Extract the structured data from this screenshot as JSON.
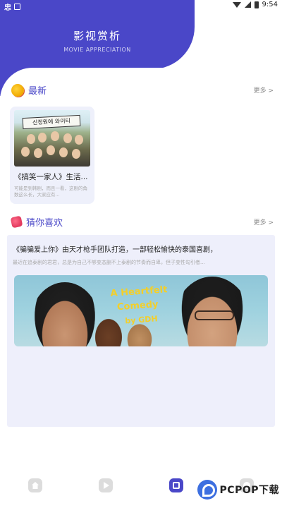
{
  "status_bar": {
    "app_badge": "忠",
    "time": "9:54"
  },
  "header": {
    "title": "影视赏析",
    "subtitle": "MOVIE APPRECIATION"
  },
  "latest": {
    "heading": "最新",
    "more": "更多 >",
    "card": {
      "poster_sign": "신정원에 와이티",
      "title": "《搞笑一家人》生活...",
      "description": "可能是到韩剧，而且一看，这剧的角数这么长，大家应有..."
    }
  },
  "guess": {
    "heading": "猜你喜欢",
    "more": "更多 >",
    "item": {
      "title": "《骗骗爱上你》由天才枪手团队打造，一部轻松愉快的泰国喜剧，",
      "description": "最近在追泰剧的君君，总是为自己不够变态删不上泰剧的节奏而自卑，但子变性勾引者...",
      "banner_text": [
        "A Heartfelt",
        "Comedy",
        "by GDH"
      ]
    }
  },
  "bottom_nav": [
    "home-icon",
    "play-icon",
    "movie-icon",
    "user-icon"
  ],
  "watermark": "PCPOP下载",
  "colors": {
    "accent": "#4a47c8",
    "panel": "#eeeffb"
  }
}
